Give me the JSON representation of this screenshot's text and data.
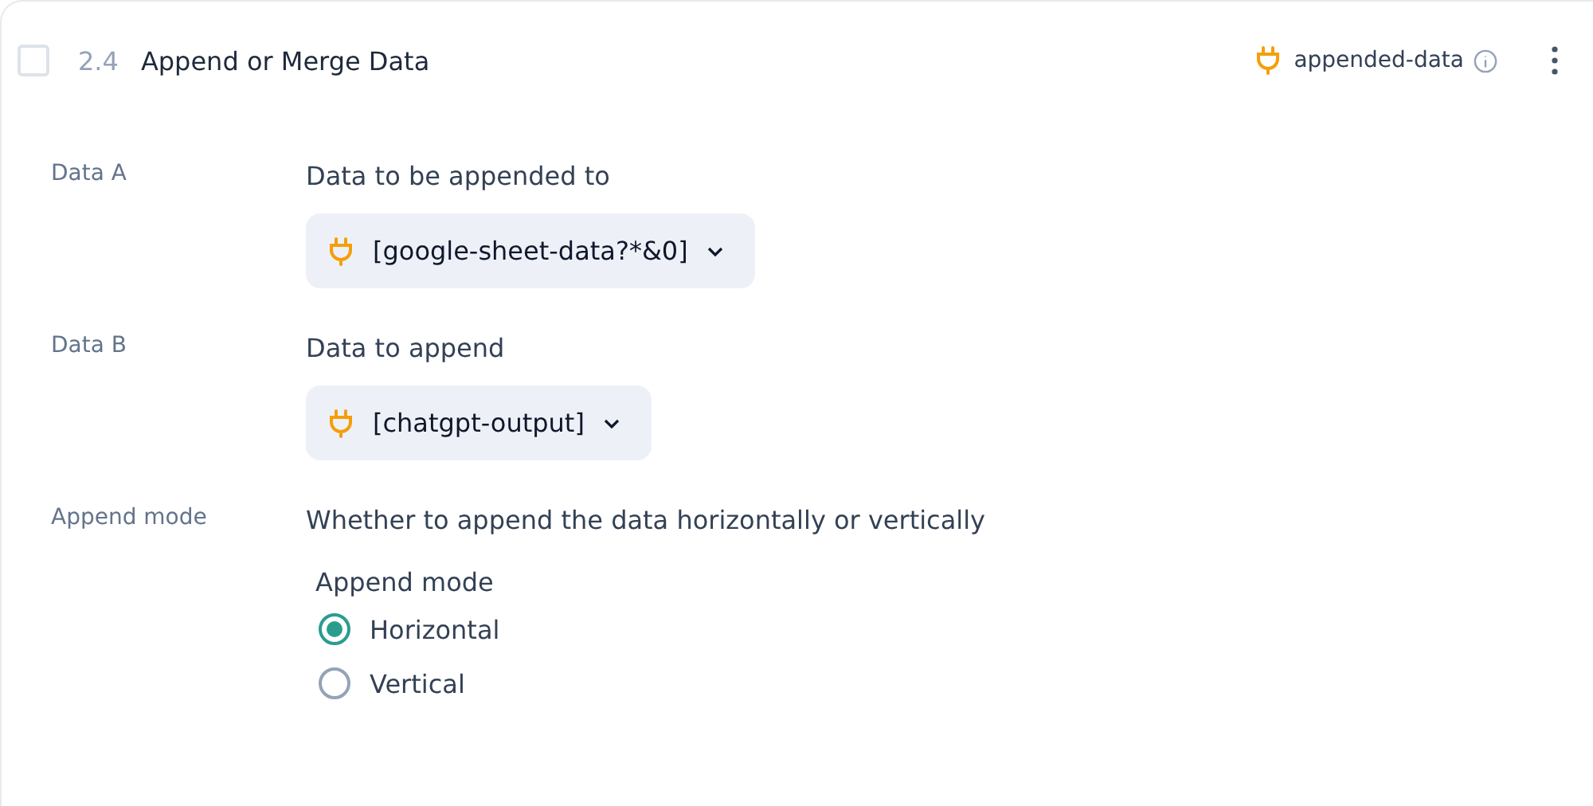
{
  "header": {
    "checked": false,
    "number": "2.4",
    "title": "Append or Merge Data",
    "output": "appended-data"
  },
  "fields": [
    {
      "kind": "select",
      "label": "Data A",
      "description": "Data to be appended to",
      "value": "[google-sheet-data?*&0]"
    },
    {
      "kind": "select",
      "label": "Data B",
      "description": "Data to append",
      "value": "[chatgpt-output]"
    },
    {
      "kind": "radio",
      "label": "Append mode",
      "description": "Whether to append the data horizontally or vertically",
      "group_label": "Append mode",
      "options": [
        {
          "label": "Horizontal",
          "selected": true
        },
        {
          "label": "Vertical",
          "selected": false
        }
      ]
    }
  ]
}
